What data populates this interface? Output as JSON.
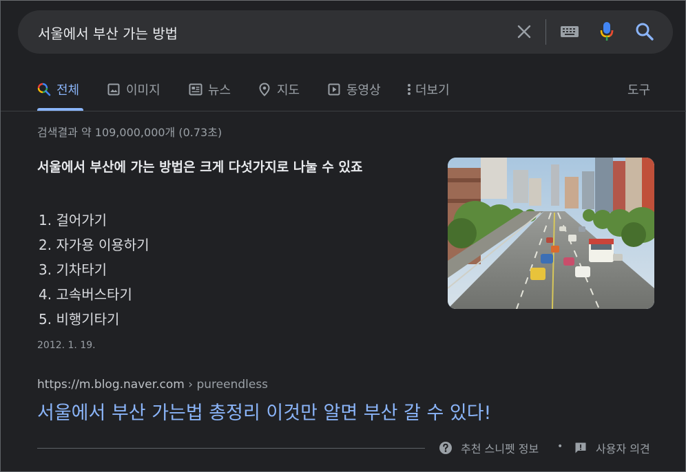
{
  "search": {
    "query": "서울에서 부산 가는 방법"
  },
  "tabs": [
    {
      "label": "전체",
      "icon": "search-icon",
      "active": true
    },
    {
      "label": "이미지",
      "icon": "image-icon"
    },
    {
      "label": "뉴스",
      "icon": "news-icon"
    },
    {
      "label": "지도",
      "icon": "map-pin-icon"
    },
    {
      "label": "동영상",
      "icon": "video-icon"
    },
    {
      "label": "더보기",
      "icon": "more-vert-icon"
    }
  ],
  "tools_label": "도구",
  "stats": "검색결과 약 109,000,000개 (0.73초)",
  "snippet": {
    "heading": "서울에서 부산에 가는 방법은 크게 다섯가지로 나눌 수 있죠",
    "items": [
      "1. 걸어가기",
      "2. 자가용 이용하기",
      "3. 기차타기",
      "4. 고속버스타기",
      "5. 비행기타기"
    ],
    "date": "2012. 1. 19."
  },
  "result": {
    "url": "https://m.blog.naver.com",
    "crumb": " › pureendless",
    "title": "서울에서 부산 가는법 총정리 이것만 알면 부산 갈 수 있다!"
  },
  "footer": {
    "snippet_info": "추천 스니펫 정보",
    "separator": "•",
    "feedback": "사용자 의견"
  },
  "colors": {
    "background": "#202124",
    "link": "#8ab4f8",
    "searchbar": "#303134"
  }
}
